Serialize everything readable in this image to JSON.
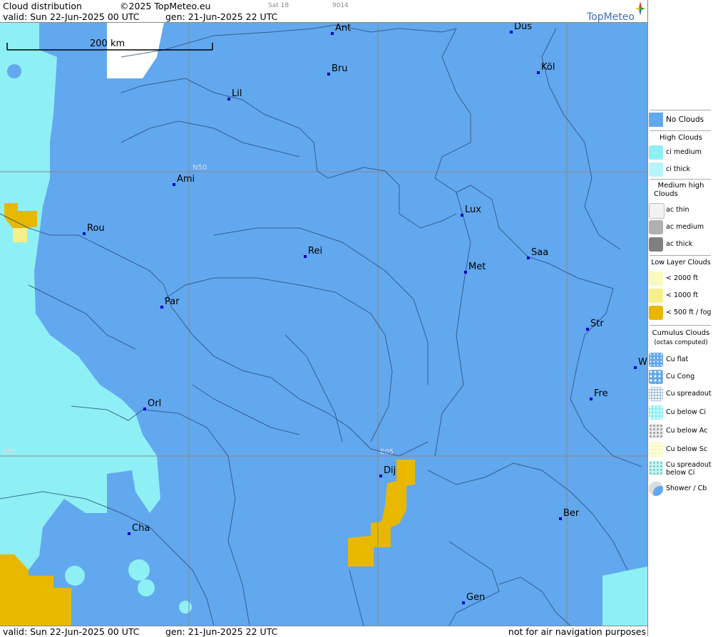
{
  "header": {
    "title": "Cloud distribution",
    "copyright": "©2025 TopMeteo.eu",
    "sat": "Sat 18",
    "code": "9014",
    "valid": "valid:  Sun  22-Jun-2025  00 UTC",
    "gen": "gen: 21-Jun-2025 22 UTC",
    "brand": "TopMeteo"
  },
  "footer": {
    "valid": "valid:  Sun  22-Jun-2025  00 UTC",
    "gen": "gen: 21-Jun-2025 22 UTC",
    "disclaimer": "not for air navigation purposes"
  },
  "map": {
    "scale_label": "200 km",
    "grid_labels": {
      "n50": "N50",
      "e00": "E00",
      "e05": "E05"
    },
    "cities": [
      {
        "name": "Ant"
      },
      {
        "name": "Düs"
      },
      {
        "name": "Bru"
      },
      {
        "name": "Köl"
      },
      {
        "name": "Lil"
      },
      {
        "name": "Ami"
      },
      {
        "name": "Rou"
      },
      {
        "name": "Lux"
      },
      {
        "name": "Rei"
      },
      {
        "name": "Saa"
      },
      {
        "name": "Met"
      },
      {
        "name": "Par"
      },
      {
        "name": "Str"
      },
      {
        "name": "W"
      },
      {
        "name": "Fre"
      },
      {
        "name": "Orl"
      },
      {
        "name": "Dij"
      },
      {
        "name": "Ber"
      },
      {
        "name": "Cha"
      },
      {
        "name": "Gen"
      }
    ],
    "colors": {
      "no_clouds": "#62a8ee",
      "ci": "#8ef0f5",
      "fog": "#e8b800",
      "low": "#f5f08a"
    }
  },
  "legend": {
    "no_clouds": "No Clouds",
    "high_head": "High Clouds",
    "ci_medium": "ci medium",
    "ci_thick": "ci thick",
    "medium_head_1": "Medium high",
    "medium_head_2": "Clouds",
    "ac_thin": "ac thin",
    "ac_medium": "ac medium",
    "ac_thick": "ac thick",
    "low_head": "Low Layer Clouds",
    "low_2000": "< 2000 ft",
    "low_1000": "< 1000 ft",
    "low_500": "< 500 ft / fog",
    "cu_head": "Cumulus Clouds",
    "cu_sub": "(octas computed)",
    "cu_flat": "Cu flat",
    "cu_cong": "Cu Cong",
    "cu_spread": "Cu spreadout",
    "cu_below_ci": "Cu below Ci",
    "cu_below_ac": "Cu below Ac",
    "cu_below_sc": "Cu below Sc",
    "cu_spread_ci_1": "Cu spreadout",
    "cu_spread_ci_2": "below Ci",
    "shower": "Shower / Cb"
  }
}
